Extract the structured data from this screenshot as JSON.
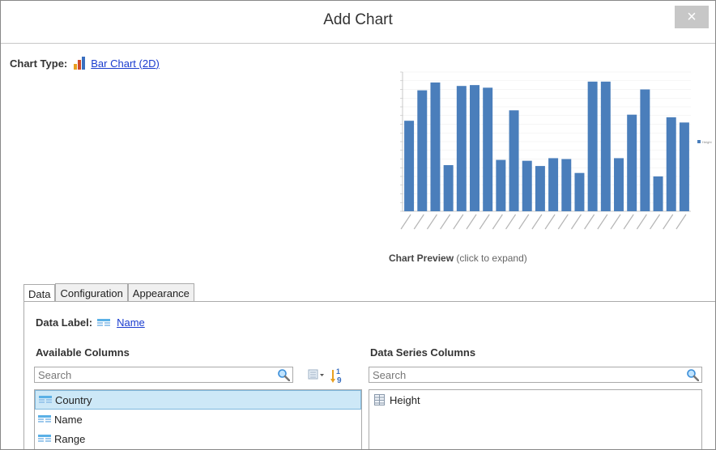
{
  "dialog": {
    "title": "Add Chart",
    "close_label": "×"
  },
  "chart_type": {
    "label": "Chart Type:",
    "value": "Bar Chart (2D)",
    "icon": "bar-chart-icon"
  },
  "preview": {
    "caption": "Chart Preview",
    "hint": "(click to expand)"
  },
  "tabs": [
    {
      "label": "Data"
    },
    {
      "label": "Configuration"
    },
    {
      "label": "Appearance"
    }
  ],
  "data_label": {
    "label": "Data Label:",
    "value": "Name",
    "icon": "column-icon"
  },
  "available": {
    "header": "Available Columns",
    "search_placeholder": "Search",
    "items": [
      {
        "label": "Country"
      },
      {
        "label": "Name"
      },
      {
        "label": "Range"
      }
    ]
  },
  "series": {
    "header": "Data Series Columns",
    "search_placeholder": "Search",
    "items": [
      {
        "label": "Height"
      }
    ]
  },
  "chart_data": {
    "type": "bar",
    "values": [
      5200,
      6950,
      7400,
      2650,
      7200,
      7250,
      7100,
      2950,
      5800,
      2900,
      2600,
      3050,
      3000,
      2200,
      7450,
      7450,
      3050,
      5550,
      7000,
      2000,
      5400,
      5100
    ],
    "ylim": [
      0,
      8000
    ],
    "legend": "Height",
    "legend_position": "right",
    "grid": true,
    "color": "#4a7ebb"
  }
}
